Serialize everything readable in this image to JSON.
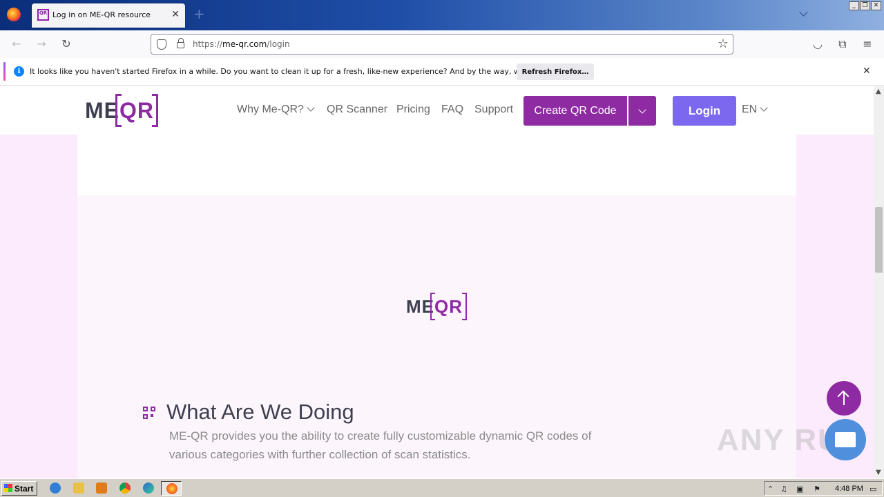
{
  "browser": {
    "tab_title": "Log in on ME-QR resource",
    "tab_favicon_text": "QR CODE",
    "url_prefix": "https://",
    "url_host": "me-qr.com",
    "url_path": "/login",
    "window_buttons": [
      "_",
      "❐",
      "✕"
    ]
  },
  "notification": {
    "text": "It looks like you haven't started Firefox in a while. Do you want to clean it up for a fresh, like-new experience? And by the way, welcome back!",
    "button": "Refresh Firefox…"
  },
  "site": {
    "logo_me": "ME",
    "logo_qr": "QR",
    "nav": {
      "why": "Why Me-QR?",
      "scanner": "QR Scanner",
      "pricing": "Pricing",
      "faq": "FAQ",
      "support": "Support"
    },
    "create_button": "Create QR Code",
    "login_button": "Login",
    "language": "EN"
  },
  "section": {
    "title": "What Are We Doing",
    "description": "ME-QR provides you the ability to create fully customizable dynamic QR codes of various categories with further collection of scan statistics."
  },
  "watermark": "ANY RUN",
  "taskbar": {
    "start": "Start",
    "clock": "4:48 PM"
  },
  "colors": {
    "brand_purple": "#8e2ba3",
    "login_violet": "#7b68ee",
    "page_bg": "#fcebfc"
  }
}
